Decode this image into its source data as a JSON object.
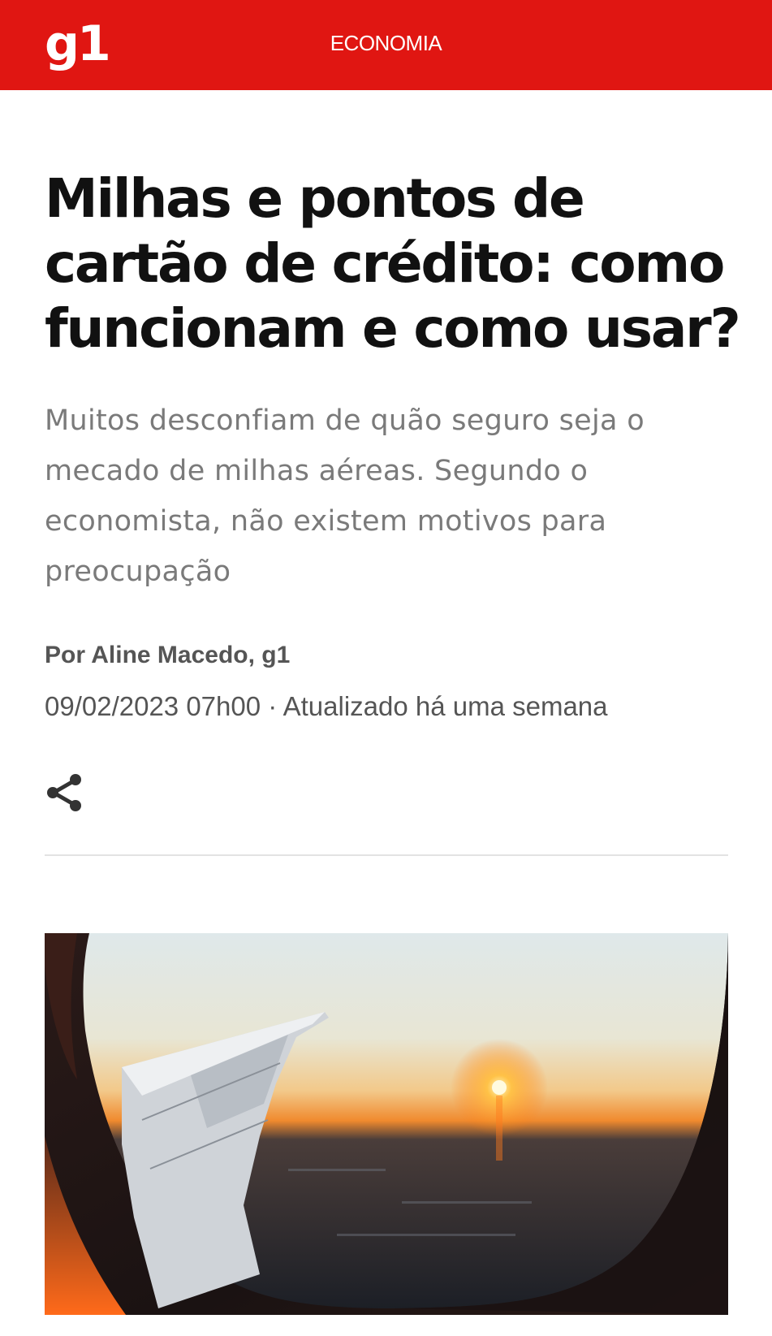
{
  "header": {
    "logo": "g1",
    "section": "ECONOMIA"
  },
  "article": {
    "title": "Milhas e pontos de cartão de crédito: como funcionam e como usar?",
    "subtitle": "Muitos desconfiam de quão seguro seja o mecado de milhas aéreas. Segundo o economista, não existem motivos para preocupação",
    "author": "Por Aline Macedo, g1",
    "date": "09/02/2023 07h00 · Atualizado há uma semana"
  },
  "icons": {
    "share": "share-icon"
  },
  "colors": {
    "brand": "#e01612",
    "title": "#111111",
    "subtitle": "#7a7a7a",
    "meta": "#555555"
  }
}
